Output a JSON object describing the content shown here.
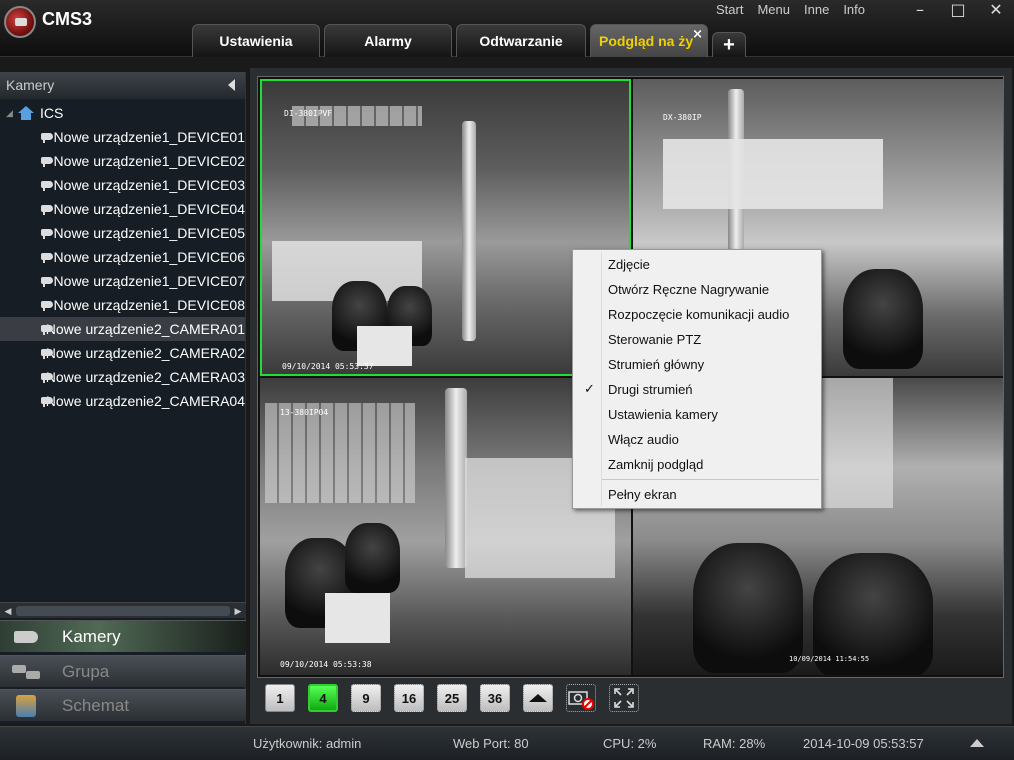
{
  "app": {
    "title": "CMS3"
  },
  "topmenu": [
    "Start",
    "Menu",
    "Inne",
    "Info"
  ],
  "window_controls": {
    "minimize": "–",
    "maximize": "□",
    "close": "✕"
  },
  "tabs": [
    {
      "label": "Ustawienia"
    },
    {
      "label": "Alarmy"
    },
    {
      "label": "Odtwarzanie"
    },
    {
      "label": "Podgląd na ży",
      "active": true,
      "close": "×"
    }
  ],
  "tab_add": "+",
  "sidebar": {
    "header": "Kamery",
    "root": "ICS",
    "items": [
      "Nowe urządzenie1_DEVICE01",
      "Nowe urządzenie1_DEVICE02",
      "Nowe urządzenie1_DEVICE03",
      "Nowe urządzenie1_DEVICE04",
      "Nowe urządzenie1_DEVICE05",
      "Nowe urządzenie1_DEVICE06",
      "Nowe urządzenie1_DEVICE07",
      "Nowe urządzenie1_DEVICE08",
      "Nowe urządzenie2_CAMERA01",
      "Nowe urządzenie2_CAMERA02",
      "Nowe urządzenie2_CAMERA03",
      "Nowe urządzenie2_CAMERA04"
    ],
    "selected_index": 8,
    "nav": [
      {
        "label": "Kamery",
        "icon": "camera-icon"
      },
      {
        "label": "Grupa",
        "icon": "group-icon"
      },
      {
        "label": "Schemat",
        "icon": "map-icon"
      }
    ]
  },
  "cameras": [
    {
      "name": "DI-380IPVF",
      "time": "09/10/2014 05:53:37"
    },
    {
      "name": "DX-380IP",
      "time": ""
    },
    {
      "name": "13-380IP04",
      "time": "09/10/2014 05:53:38"
    },
    {
      "name": "",
      "time": "10/09/2014 11:54:55"
    }
  ],
  "toolbar": {
    "layouts": [
      "1",
      "4",
      "9",
      "16",
      "25",
      "36"
    ],
    "active_layout": "4"
  },
  "context_menu": {
    "items": [
      {
        "label": "Zdjęcie",
        "checked": false
      },
      {
        "label": "Otwórz Ręczne Nagrywanie",
        "checked": false
      },
      {
        "label": "Rozpoczęcie komunikacji audio",
        "checked": false
      },
      {
        "label": "Sterowanie PTZ",
        "checked": false
      },
      {
        "label": "Strumień główny",
        "checked": false
      },
      {
        "label": "Drugi strumień",
        "checked": true
      },
      {
        "label": "Ustawienia kamery",
        "checked": false
      },
      {
        "label": "Włącz audio",
        "checked": false
      },
      {
        "label": "Zamknij podgląd",
        "checked": false
      }
    ],
    "footer_item": "Pełny ekran",
    "check_glyph": "✓"
  },
  "status": {
    "user": "Użytkownik: admin",
    "port": "Web Port: 80",
    "cpu": "CPU: 2%",
    "ram": "RAM: 28%",
    "datetime": "2014-10-09 05:53:57"
  },
  "colors": {
    "accent_green": "#22dd33",
    "active_tab_text": "#f0d000"
  }
}
